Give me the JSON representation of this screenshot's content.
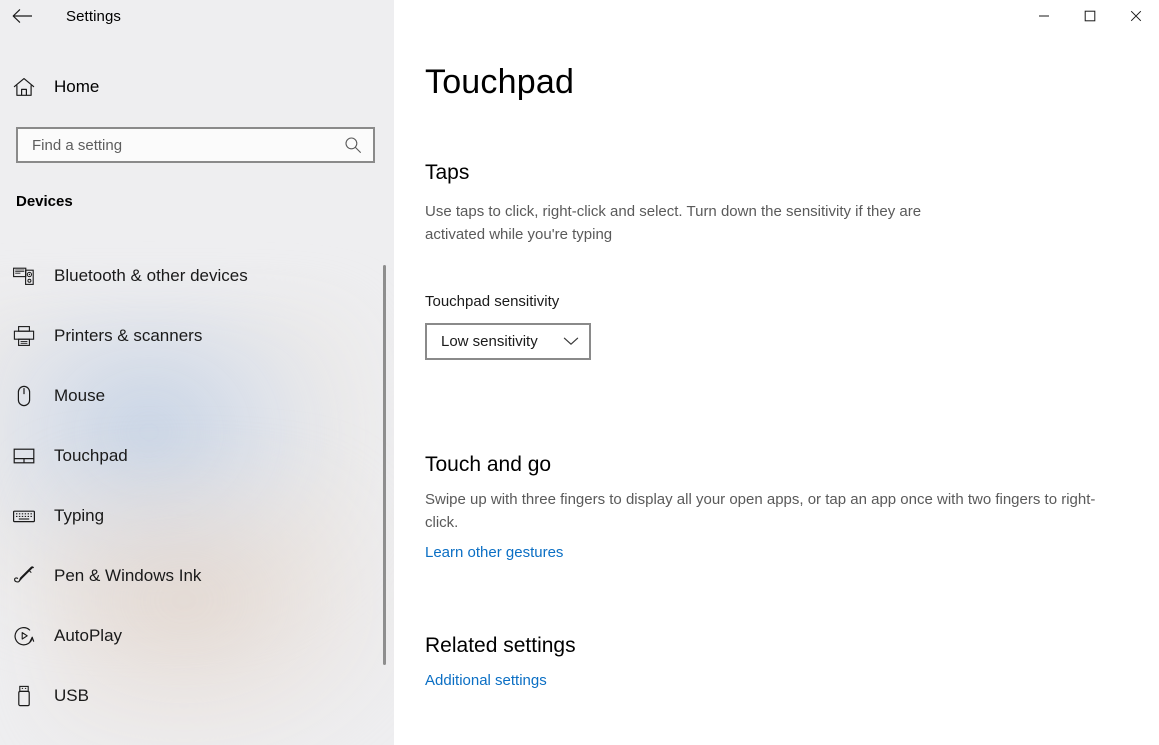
{
  "window": {
    "app_title": "Settings",
    "back_icon": "back-arrow-icon",
    "controls": {
      "minimize_label": "Minimize",
      "maximize_label": "Maximize",
      "close_label": "Close"
    }
  },
  "sidebar": {
    "home": {
      "label": "Home",
      "icon": "home-icon"
    },
    "search": {
      "placeholder": "Find a setting",
      "value": "",
      "icon": "search-icon"
    },
    "group_header": "Devices",
    "items": [
      {
        "label": "Bluetooth & other devices",
        "icon": "bluetooth-devices-icon",
        "selected": false
      },
      {
        "label": "Printers & scanners",
        "icon": "printer-icon",
        "selected": false
      },
      {
        "label": "Mouse",
        "icon": "mouse-icon",
        "selected": false
      },
      {
        "label": "Touchpad",
        "icon": "touchpad-icon",
        "selected": true
      },
      {
        "label": "Typing",
        "icon": "keyboard-icon",
        "selected": false
      },
      {
        "label": "Pen & Windows Ink",
        "icon": "pen-icon",
        "selected": false
      },
      {
        "label": "AutoPlay",
        "icon": "autoplay-icon",
        "selected": false
      },
      {
        "label": "USB",
        "icon": "usb-icon",
        "selected": false
      }
    ]
  },
  "main": {
    "page_title": "Touchpad",
    "sections": {
      "taps": {
        "title": "Taps",
        "description": "Use taps to click, right-click and select. Turn down the sensitivity if they are activated while you're typing",
        "sensitivity_label": "Touchpad sensitivity",
        "sensitivity_value": "Low sensitivity",
        "sensitivity_chevron": "chevron-down-icon"
      },
      "touch_and_go": {
        "title": "Touch and go",
        "description": "Swipe up with three fingers to display all your open apps, or tap an app once with two fingers to right-click.",
        "link": "Learn other gestures"
      },
      "related": {
        "title": "Related settings",
        "link": "Additional settings"
      }
    }
  },
  "colors": {
    "accent_link": "#0b6fc4",
    "sidebar_bg": "#eeeef0",
    "main_bg": "#ffffff",
    "body_text": "#1a1a1a",
    "muted_text": "#5a5a5a",
    "control_border": "#8a8a8a",
    "close_hover": "#e81123"
  }
}
